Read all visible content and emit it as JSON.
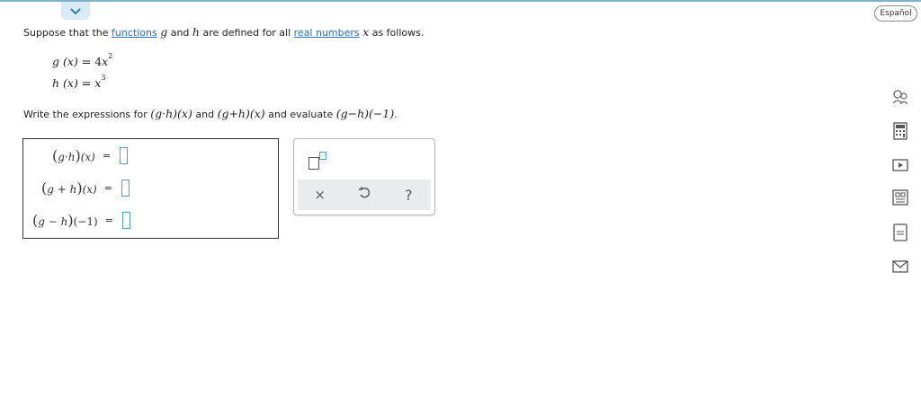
{
  "header": {
    "collapse_icon": "chevron-down-icon",
    "language_button": "Español"
  },
  "problem": {
    "intro_before": "Suppose that the ",
    "link_functions": "functions",
    "var_g": "g",
    "word_and": " and ",
    "var_h": "h",
    "mid_text": " are defined for all ",
    "link_real_numbers": "real numbers",
    "var_x": "x",
    "tail_text": " as follows."
  },
  "definitions": [
    {
      "lhs": "g (x)",
      "eq": " = ",
      "coef": "4",
      "base": "x",
      "exp": "2"
    },
    {
      "lhs": "h (x)",
      "eq": " = ",
      "coef": "",
      "base": "x",
      "exp": "3"
    }
  ],
  "instruction": {
    "prefix": "Write the expressions for ",
    "expr1": "(g·h)(x)",
    "and_text": " and ",
    "expr2": "(g+h)(x)",
    "mid": " and evaluate ",
    "expr3": "(g−h)(−1)",
    "period": "."
  },
  "answers": [
    {
      "left_paren": "(",
      "inner": "g·h",
      "right_paren": ")",
      "arg": "(x)",
      "equals": "=",
      "value": ""
    },
    {
      "left_paren": "(",
      "inner": "g + h",
      "right_paren": ")",
      "arg": "(x)",
      "equals": "=",
      "value": ""
    },
    {
      "left_paren": "(",
      "inner": "g − h",
      "right_paren": ")",
      "arg": "(−1)",
      "equals": "=",
      "value": ""
    }
  ],
  "toolbar": {
    "exponent_icon": "superscript-icon",
    "clear_label": "×",
    "undo_icon": "undo-icon",
    "help_label": "?"
  },
  "sidebar_icons": [
    "ask-question-icon",
    "calculator-icon",
    "video-icon",
    "textbook-icon",
    "glossary-icon",
    "mail-icon"
  ],
  "colors": {
    "link": "#2a6db5",
    "input_slot": "#4a9fd0",
    "top_bar": "#7fb3cc",
    "tool_row_bg": "#e9ebed"
  }
}
